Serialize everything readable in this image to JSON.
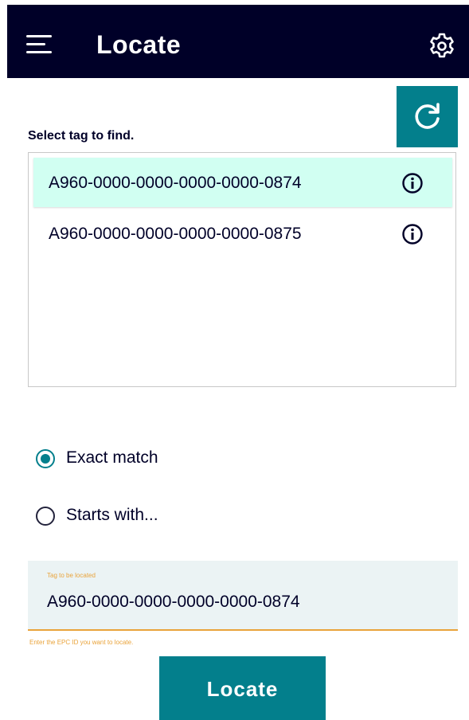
{
  "header": {
    "title": "Locate",
    "menu_icon": "hamburger-menu-icon",
    "settings_icon": "gear-icon"
  },
  "refresh_icon": "refresh-icon",
  "tag_list": {
    "label": "Select tag to find.",
    "items": [
      {
        "epc": "A960-0000-0000-0000-0000-0874",
        "selected": true,
        "icon": "info-icon"
      },
      {
        "epc": "A960-0000-0000-0000-0000-0875",
        "selected": false,
        "icon": "info-icon"
      }
    ]
  },
  "match_mode": {
    "options": [
      {
        "label": "Exact match",
        "checked": true
      },
      {
        "label": "Starts with...",
        "checked": false
      }
    ]
  },
  "tag_input": {
    "label": "Tag to be located",
    "value": "A960-0000-0000-0000-0000-0874",
    "helper": "Enter the EPC ID you want to locate."
  },
  "locate_button": {
    "label": "Locate"
  },
  "colors": {
    "header_bg": "#000028",
    "accent": "#037f8c",
    "selected_row_bg": "#d1fff2",
    "input_bg": "#ebf3f4",
    "helper_text": "#e9a33a"
  }
}
